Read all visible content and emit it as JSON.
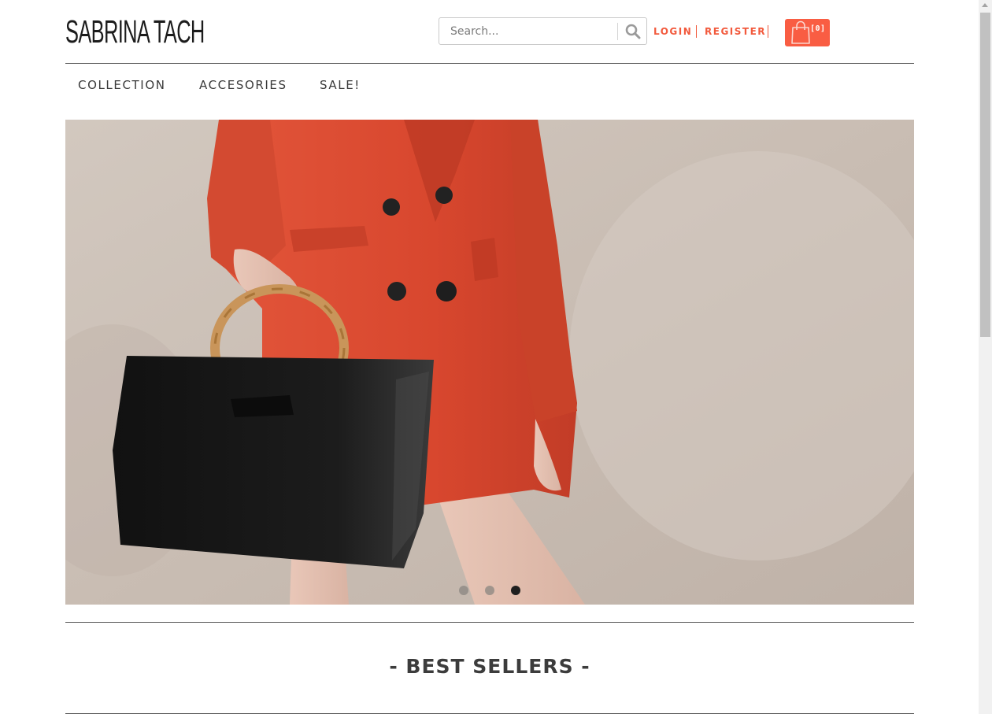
{
  "brand": {
    "logo_text": "SABRINA TACH"
  },
  "search": {
    "placeholder": "Search..."
  },
  "account": {
    "login_label": "LOGIN",
    "register_label": "REGISTER"
  },
  "cart": {
    "count_label": "[0]",
    "icon": "shopping-bag-icon"
  },
  "nav": {
    "items": [
      {
        "label": "COLLECTION"
      },
      {
        "label": "ACCESORIES"
      },
      {
        "label": "SALE!"
      }
    ]
  },
  "hero": {
    "slides": [
      "slide-1",
      "slide-2",
      "slide-3"
    ],
    "active_slide": 3
  },
  "sections": {
    "best_sellers_title": "- BEST SELLERS -"
  },
  "colors": {
    "accent": "#f25a3d",
    "cart_bg": "#f95d43",
    "text_dark": "#3c3c3c"
  }
}
